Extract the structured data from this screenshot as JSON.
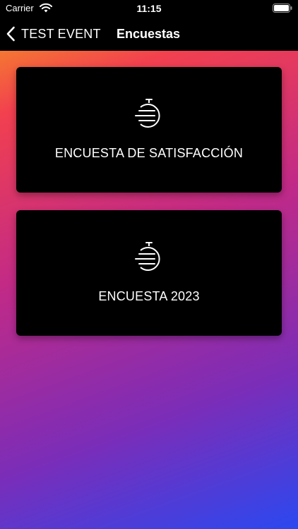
{
  "status_bar": {
    "carrier": "Carrier",
    "time": "11:15",
    "wifi_icon": "wifi-icon",
    "battery_icon": "battery-icon"
  },
  "nav": {
    "back_label": "TEST EVENT",
    "back_icon": "chevron-left-icon",
    "title": "Encuestas"
  },
  "surveys": [
    {
      "label": "ENCUESTA DE SATISFACCIÓN",
      "icon": "stopwatch-icon"
    },
    {
      "label": "ENCUESTA 2023",
      "icon": "stopwatch-icon"
    }
  ],
  "colors": {
    "bar_background": "#000000",
    "card_background": "#000000",
    "text": "#ffffff",
    "gradient": [
      "#f7a21b",
      "#f2404f",
      "#c22a86",
      "#7b2db8",
      "#2b48f0"
    ]
  }
}
